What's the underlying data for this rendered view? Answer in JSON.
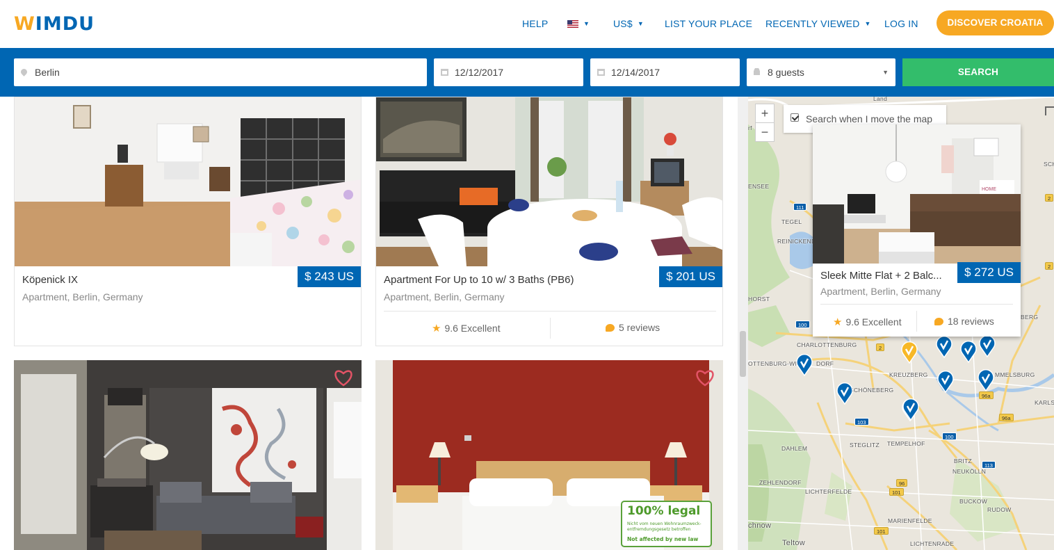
{
  "header": {
    "logo": "WIMDU",
    "nav": {
      "help": "HELP",
      "currency": "US$",
      "list_your_place": "LIST YOUR PLACE",
      "recently_viewed": "RECENTLY VIEWED",
      "log_in": "LOG IN"
    },
    "cta": "DISCOVER CROATIA"
  },
  "search": {
    "location": "Berlin",
    "checkin": "12/12/2017",
    "checkout": "12/14/2017",
    "guests": "8 guests",
    "button": "SEARCH"
  },
  "listings": [
    {
      "title": "Köpenick IX",
      "subtitle": "Apartment, Berlin, Germany",
      "price": "$ 243 US"
    },
    {
      "title": "Apartment For Up to 10 w/ 3 Baths (PB6)",
      "subtitle": "Apartment, Berlin, Germany",
      "price": "$ 201 US",
      "rating": "9.6 Excellent",
      "reviews": "5 reviews"
    },
    {
      "title": "",
      "badge": {
        "line1": "100% legal",
        "line2": "Nicht vom neuen Wohnraumzweck-",
        "line3": "entfremdungsgesetz betroffen",
        "line4": "Not affected by new law"
      }
    }
  ],
  "map": {
    "search_when_move": "Search when I move the map",
    "zoom_in": "+",
    "zoom_out": "−",
    "popup": {
      "title": "Sleek Mitte Flat + 2 Balc...",
      "subtitle": "Apartment, Berlin, Germany",
      "price": "$ 272 US",
      "rating": "9.6 Excellent",
      "reviews": "18 reviews"
    },
    "labels": {
      "land": "Land",
      "tegel": "TEGEL",
      "reinickend": "REINICKEND",
      "ensee": "ENSEE",
      "horst": "HORST",
      "charlottenburg": "CHARLOTTENBURG",
      "ottenburg_wil": "OTTENBURG-WI",
      "dorf": "DORF",
      "kreuzberg": "KREUZBERG",
      "schoneberg": "SCHÖNEBERG",
      "steglitz": "STEGLITZ",
      "tempelhof": "TEMPELHOF",
      "dahlem": "DAHLEM",
      "zehlendorf": "ZEHLENDORF",
      "lichterfelde": "LICHTERFELDE",
      "mariendorf": "MARIENFELDE",
      "lichtenrade": "LICHTENRADE",
      "britz": "BRITZ",
      "neukolln": "NEUKÖLLN",
      "buckow": "BUCKOW",
      "rudow": "RUDOW",
      "karlsh": "KARLSH",
      "mmelsburg": "MMELSBURG",
      "bergm": "BERG",
      "teltow": "Teltow",
      "chnow": "chnow",
      "sch": "SCH",
      "rf": "rf"
    },
    "roads": [
      "111",
      "111",
      "100",
      "100",
      "103",
      "100",
      "96a",
      "96a",
      "113",
      "96",
      "101",
      "101",
      "2",
      "2",
      "2"
    ]
  },
  "colors": {
    "brand_blue": "#0066b3",
    "brand_orange": "#f7a823",
    "search_green": "#33bd6b"
  }
}
